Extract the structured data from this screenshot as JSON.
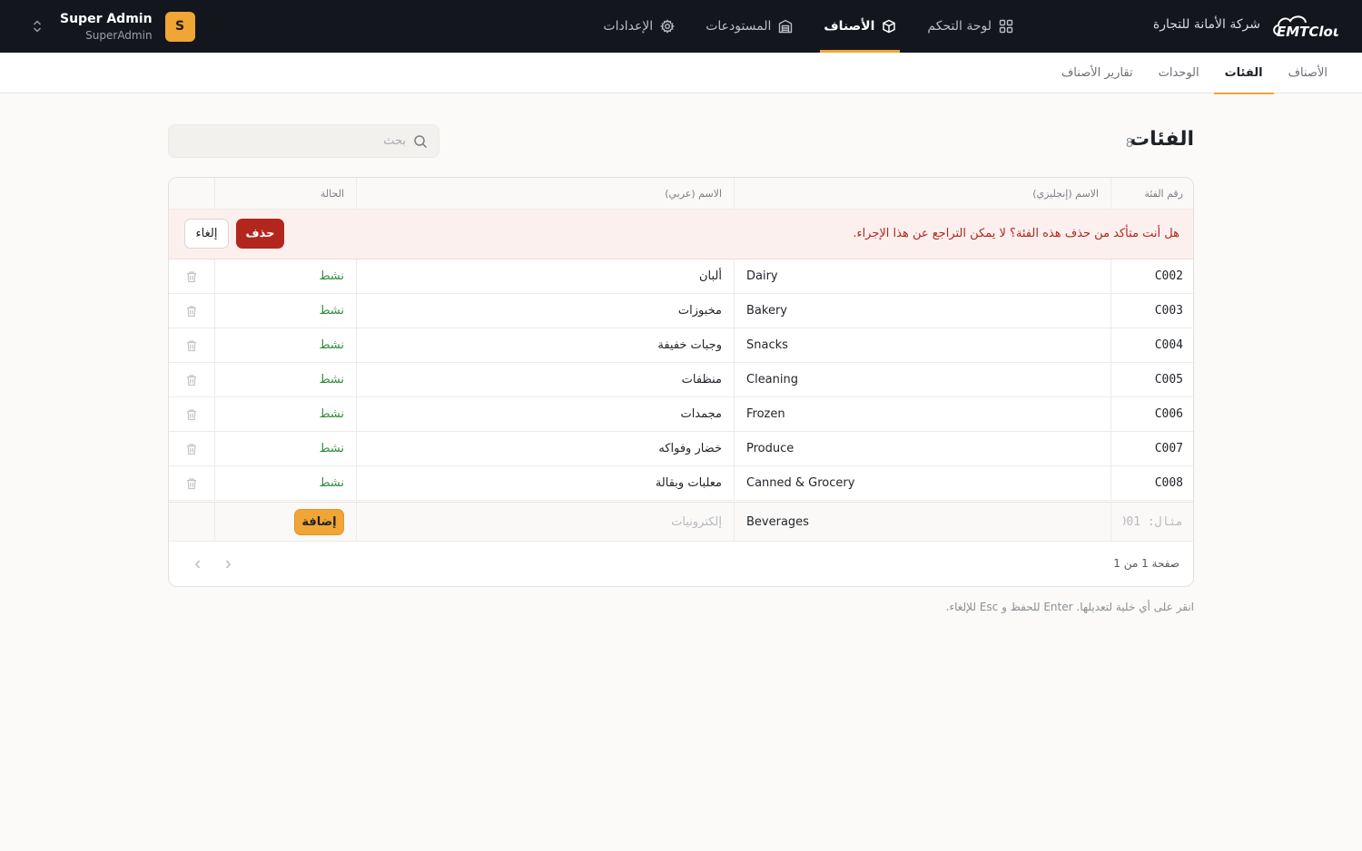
{
  "header": {
    "company_name": "شركة الأمانة للتجارة",
    "logo_text": "EMTCloud",
    "nav": [
      {
        "label": "لوحة التحكم",
        "icon": "dashboard-icon"
      },
      {
        "label": "الأصناف",
        "icon": "box-icon",
        "active": true
      },
      {
        "label": "المستودعات",
        "icon": "warehouse-icon"
      },
      {
        "label": "الإعدادات",
        "icon": "gear-icon"
      }
    ],
    "user": {
      "name": "Super Admin",
      "role": "SuperAdmin",
      "initial": "S"
    }
  },
  "subtabs": [
    {
      "label": "الأصناف"
    },
    {
      "label": "الفئات",
      "active": true
    },
    {
      "label": "الوحدات"
    },
    {
      "label": "تقارير الأصناف"
    }
  ],
  "page": {
    "title": "الفئات",
    "count": "8",
    "search_placeholder": "بحث"
  },
  "table": {
    "columns": {
      "code": "رقم الفئة",
      "name_en": "الاسم (إنجليزي)",
      "name_ar": "الاسم (عربي)",
      "status": "الحالة"
    },
    "confirm": {
      "message": "هل أنت متأكد من حذف هذه الفئة؟ لا يمكن التراجع عن هذا الإجراء.",
      "delete_label": "حذف",
      "cancel_label": "إلغاء"
    },
    "rows": [
      {
        "code": "C002",
        "name_en": "Dairy",
        "name_ar": "ألبان",
        "status": "نشط"
      },
      {
        "code": "C003",
        "name_en": "Bakery",
        "name_ar": "مخبوزات",
        "status": "نشط"
      },
      {
        "code": "C004",
        "name_en": "Snacks",
        "name_ar": "وجبات خفيفة",
        "status": "نشط"
      },
      {
        "code": "C005",
        "name_en": "Cleaning",
        "name_ar": "منظفات",
        "status": "نشط"
      },
      {
        "code": "C006",
        "name_en": "Frozen",
        "name_ar": "مجمدات",
        "status": "نشط"
      },
      {
        "code": "C007",
        "name_en": "Produce",
        "name_ar": "خضار وفواكه",
        "status": "نشط"
      },
      {
        "code": "C008",
        "name_en": "Canned & Grocery",
        "name_ar": "معلبات وبقالة",
        "status": "نشط"
      }
    ],
    "new_row": {
      "code_placeholder": "مثال: 001",
      "name_en_value": "Beverages",
      "name_ar_placeholder": "إلكترونيات",
      "add_label": "إضافة"
    },
    "pagination": "صفحة 1 من 1"
  },
  "footer_hint": "انقر على أي خلية لتعديلها. Enter للحفظ و Esc للإلغاء.",
  "colors": {
    "accent": "#f0a534",
    "danger": "#b3261e",
    "active_status": "#2e8a3c",
    "topbar": "#13171d"
  }
}
